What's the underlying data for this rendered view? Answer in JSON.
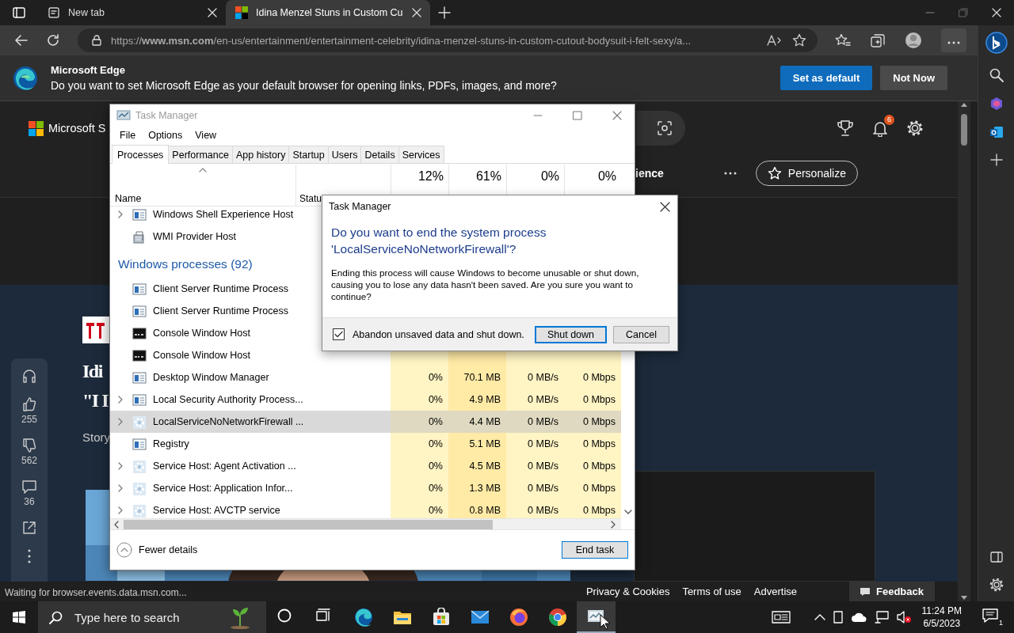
{
  "browser": {
    "tabs": [
      {
        "title": "New tab",
        "selected": false,
        "kind": "newtab"
      },
      {
        "title": "Idina Menzel Stuns in Custom Cu",
        "selected": true,
        "kind": "msn"
      }
    ],
    "address": {
      "url": "https://**www.msn.com**/en-us/entertainment/entertainment-celebrity/idina-menzel-stuns-in-custom-cutout-bodysuit-i-felt-sexy/a..."
    },
    "infobar": {
      "title": "Microsoft Edge",
      "message": "Do you want to set Microsoft Edge as your default browser for opening links, PDFs, images, and more?",
      "buttons": [
        {
          "label": "Set as default",
          "primary": true
        },
        {
          "label": "Not Now",
          "primary": false
        }
      ]
    },
    "status_text": "Waiting for browser.events.data.msn.com..."
  },
  "msn": {
    "logo_text": "Microsoft S",
    "nav_text": "ience",
    "notification_count": "6",
    "personalize": "Personalize",
    "article": {
      "title_lines": [
        "Idi",
        "\"I I"
      ],
      "byline": "Story",
      "reactions": [
        {
          "kind": "listen"
        },
        {
          "kind": "like",
          "count": "255"
        },
        {
          "kind": "dislike",
          "count": "562"
        },
        {
          "kind": "comment",
          "count": "36"
        },
        {
          "kind": "share"
        },
        {
          "kind": "more"
        }
      ]
    },
    "footer_links": [
      "Privacy & Cookies",
      "Terms of use",
      "Advertise"
    ],
    "feedback": "Feedback"
  },
  "task_manager": {
    "title": "Task Manager",
    "menu": [
      "File",
      "Options",
      "View"
    ],
    "tabs": [
      {
        "label": "Processes",
        "selected": true
      },
      {
        "label": "Performance",
        "selected": false
      },
      {
        "label": "App history",
        "selected": false
      },
      {
        "label": "Startup",
        "selected": false
      },
      {
        "label": "Users",
        "selected": false
      },
      {
        "label": "Details",
        "selected": false
      },
      {
        "label": "Services",
        "selected": false
      }
    ],
    "usage": [
      "12%",
      "61%",
      "0%",
      "0%"
    ],
    "name_header": "Name",
    "status_header": "Statu",
    "rows": [
      {
        "kind": "window",
        "name": "Windows Shell Experience Host",
        "expandable": true,
        "selected": false
      },
      {
        "kind": "wmi",
        "name": "WMI Provider Host",
        "expandable": false,
        "selected": false
      },
      {
        "kind": "group",
        "name": "Windows processes (92)"
      },
      {
        "kind": "window",
        "name": "Client Server Runtime Process",
        "expandable": false,
        "selected": false
      },
      {
        "kind": "window",
        "name": "Client Server Runtime Process",
        "expandable": false,
        "selected": false
      },
      {
        "kind": "console",
        "name": "Console Window Host",
        "expandable": false,
        "selected": false
      },
      {
        "kind": "console",
        "name": "Console Window Host",
        "expandable": false,
        "selected": false
      },
      {
        "kind": "window",
        "name": "Desktop Window Manager",
        "expandable": false,
        "selected": false,
        "cpu": "0%",
        "memory": "70.1 MB",
        "disk": "0 MB/s",
        "network": "0 Mbps"
      },
      {
        "kind": "window",
        "name": "Local Security Authority Process...",
        "expandable": true,
        "selected": false,
        "cpu": "0%",
        "memory": "4.9 MB",
        "disk": "0 MB/s",
        "network": "0 Mbps"
      },
      {
        "kind": "service",
        "name": "LocalServiceNoNetworkFirewall ...",
        "expandable": true,
        "selected": true,
        "cpu": "0%",
        "memory": "4.4 MB",
        "disk": "0 MB/s",
        "network": "0 Mbps"
      },
      {
        "kind": "window",
        "name": "Registry",
        "expandable": false,
        "selected": false,
        "cpu": "0%",
        "memory": "5.1 MB",
        "disk": "0 MB/s",
        "network": "0 Mbps"
      },
      {
        "kind": "service",
        "name": "Service Host: Agent Activation ...",
        "expandable": true,
        "selected": false,
        "cpu": "0%",
        "memory": "4.5 MB",
        "disk": "0 MB/s",
        "network": "0 Mbps"
      },
      {
        "kind": "service",
        "name": "Service Host: Application Infor...",
        "expandable": true,
        "selected": false,
        "cpu": "0%",
        "memory": "1.3 MB",
        "disk": "0 MB/s",
        "network": "0 Mbps"
      },
      {
        "kind": "service",
        "name": "Service Host: AVCTP service",
        "expandable": true,
        "selected": false,
        "cpu": "0%",
        "memory": "0.8 MB",
        "disk": "0 MB/s",
        "network": "0 Mbps"
      }
    ],
    "fewer_details": "Fewer details",
    "end_task": "End task"
  },
  "dialog": {
    "title": "Task Manager",
    "heading": "Do you want to end the system process 'LocalServiceNoNetworkFirewall'?",
    "body": "Ending this process will cause Windows to become unusable or shut down, causing you to lose any data hasn't been saved. Are you sure you want to continue?",
    "checkbox": {
      "label": "Abandon unsaved data and shut down.",
      "checked": true
    },
    "buttons": [
      {
        "label": "Shut down",
        "default": true
      },
      {
        "label": "Cancel",
        "default": false
      }
    ]
  },
  "taskbar": {
    "search_placeholder": "Type here to search",
    "apps": [
      {
        "kind": "cortana",
        "selected": false
      },
      {
        "kind": "taskview",
        "selected": false
      },
      {
        "kind": "edge",
        "selected": false
      },
      {
        "kind": "explorer",
        "selected": false
      },
      {
        "kind": "store",
        "selected": false
      },
      {
        "kind": "mail",
        "selected": false
      },
      {
        "kind": "firefox",
        "selected": false
      },
      {
        "kind": "chrome",
        "selected": false
      },
      {
        "kind": "taskmgr",
        "selected": true
      }
    ],
    "time": "11:24 PM",
    "date": "6/5/2023",
    "notifications": "1"
  }
}
